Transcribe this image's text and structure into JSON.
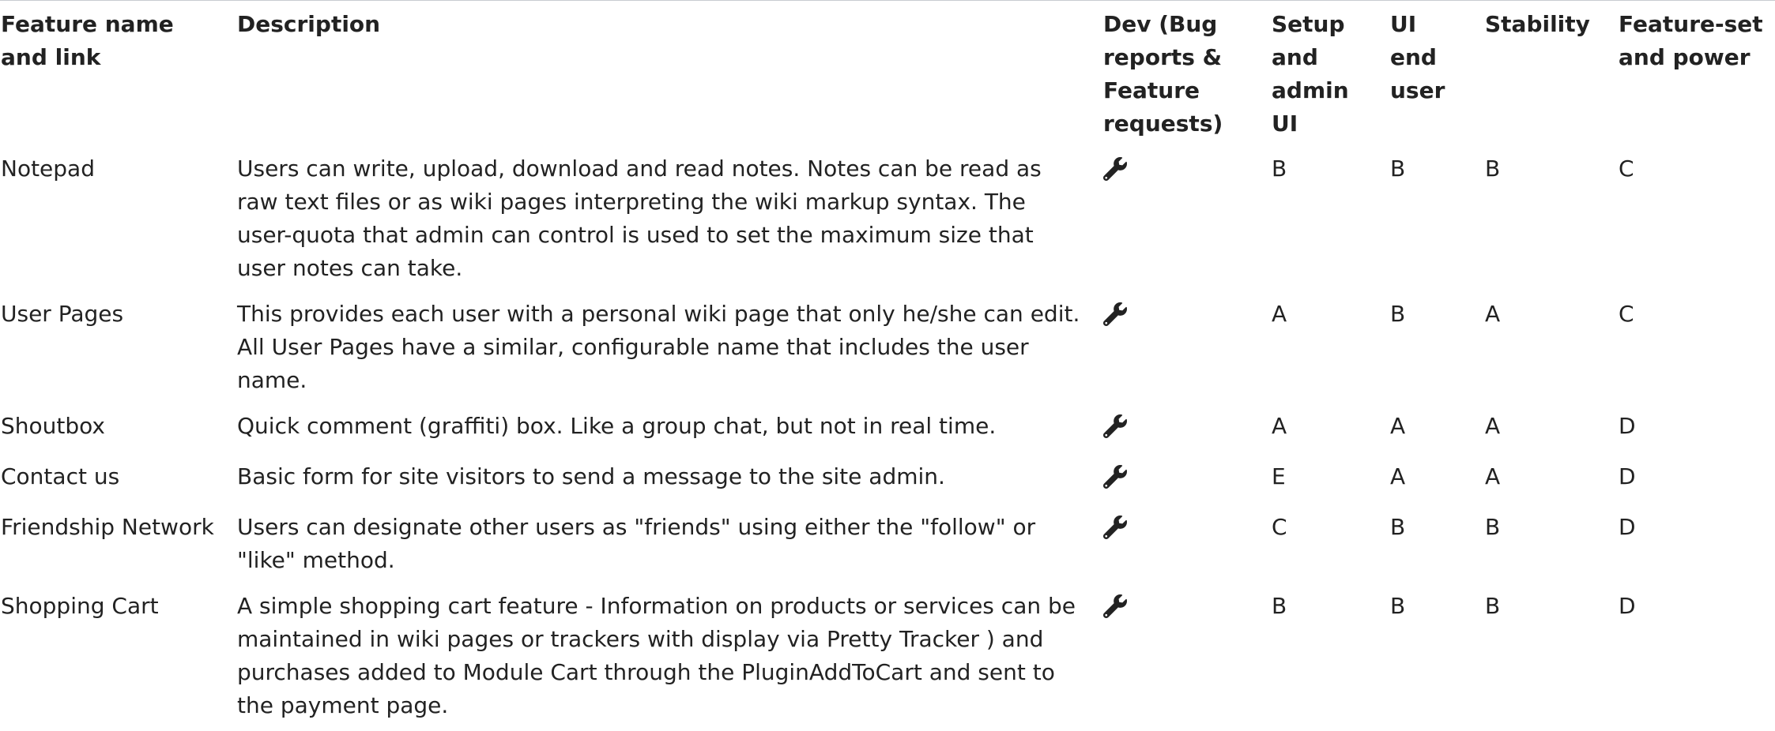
{
  "table": {
    "headers": [
      "Feature name and link",
      "Description",
      "Dev (Bug reports & Feature requests)",
      "Setup and admin UI",
      "UI end user",
      "Stability",
      "Feature-set and power"
    ],
    "rows": [
      {
        "name": "Notepad",
        "description": "Users can write, upload, download and read notes. Notes can be read as raw text files or as wiki pages interpreting the wiki markup syntax. The user-quota that admin can control is used to set the maximum size that user notes can take.",
        "dev_icon": "wrench-icon",
        "setup": "B",
        "ui": "B",
        "stability": "B",
        "featureset": "C"
      },
      {
        "name": "User Pages",
        "description": "This provides each user with a personal wiki page that only he/she can edit. All User Pages have a similar, configurable name that includes the user name.",
        "dev_icon": "wrench-icon",
        "setup": "A",
        "ui": "B",
        "stability": "A",
        "featureset": "C"
      },
      {
        "name": "Shoutbox",
        "description": "Quick comment (graffiti) box. Like a group chat, but not in real time.",
        "dev_icon": "wrench-icon",
        "setup": "A",
        "ui": "A",
        "stability": "A",
        "featureset": "D"
      },
      {
        "name": "Contact us",
        "description": "Basic form for site visitors to send a message to the site admin.",
        "dev_icon": "wrench-icon",
        "setup": "E",
        "ui": "A",
        "stability": "A",
        "featureset": "D"
      },
      {
        "name": "Friendship Network",
        "description": "Users can designate other users as \"friends\" using either the \"follow\" or \"like\" method.",
        "dev_icon": "wrench-icon",
        "setup": "C",
        "ui": "B",
        "stability": "B",
        "featureset": "D"
      },
      {
        "name": "Shopping Cart",
        "description": "A simple shopping cart feature - Information on products or services can be maintained in wiki pages or trackers with display via Pretty Tracker ) and purchases added to Module Cart through the PluginAddToCart and sent to the payment page.",
        "dev_icon": "wrench-icon",
        "setup": "B",
        "ui": "B",
        "stability": "B",
        "featureset": "D"
      }
    ]
  }
}
